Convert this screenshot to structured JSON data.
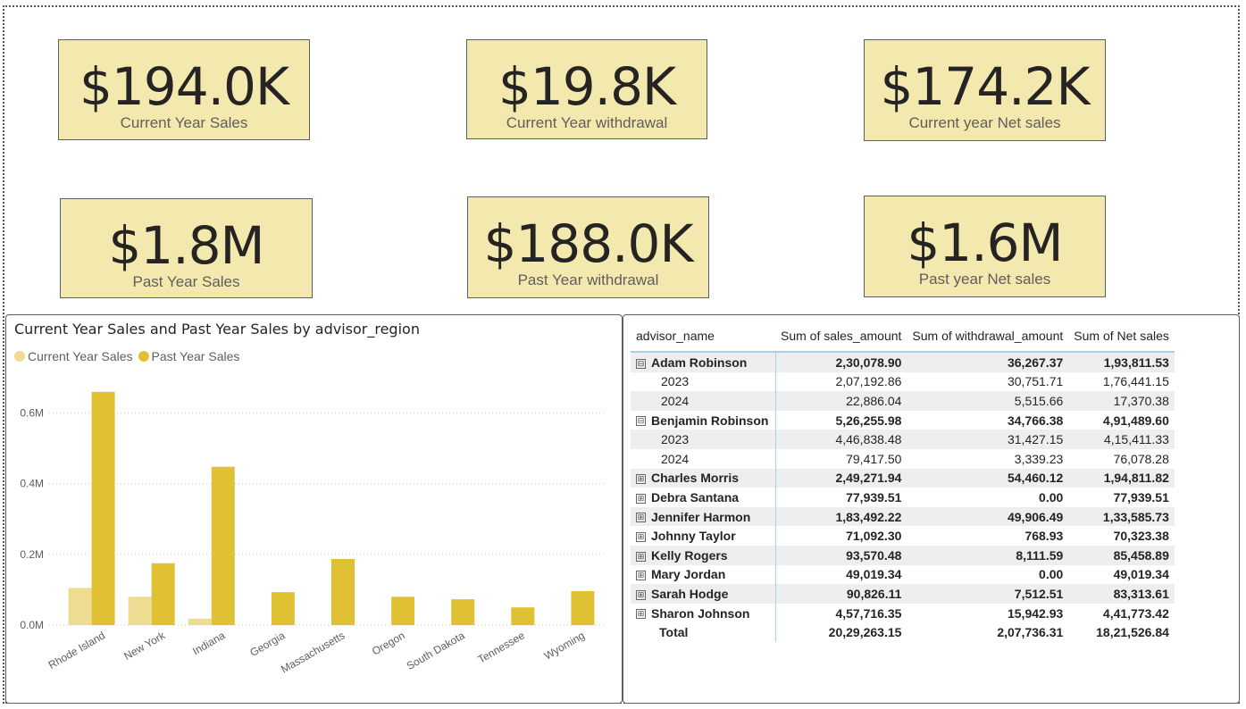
{
  "cards": [
    {
      "value": "$194.0K",
      "label": "Current Year  Sales"
    },
    {
      "value": "$19.8K",
      "label": "Current Year withdrawal"
    },
    {
      "value": "$174.2K",
      "label": "Current year Net sales"
    },
    {
      "value": "$1.8M",
      "label": "Past Year Sales"
    },
    {
      "value": "$188.0K",
      "label": "Past Year withdrawal"
    },
    {
      "value": "$1.6M",
      "label": "Past year Net sales"
    }
  ],
  "colors": {
    "card_bg": "#f3e8ae",
    "current": "#efdc93",
    "past": "#e0c133"
  },
  "chart_data": {
    "type": "bar",
    "title": "Current Year Sales and Past Year Sales by advisor_region",
    "categories": [
      "Rhode Island",
      "New York",
      "Indiana",
      "Georgia",
      "Massachusetts",
      "Oregon",
      "South Dakota",
      "Tennessee",
      "Wyoming"
    ],
    "series": [
      {
        "name": "Current Year  Sales",
        "values": [
          0.105,
          0.08,
          0.018,
          0,
          0,
          0,
          0,
          0,
          0
        ]
      },
      {
        "name": "Past Year Sales",
        "values": [
          0.66,
          0.175,
          0.448,
          0.093,
          0.187,
          0.08,
          0.073,
          0.05,
          0.096
        ]
      }
    ],
    "yticks": [
      "0.0M",
      "0.2M",
      "0.4M",
      "0.6M"
    ],
    "ytick_values": [
      0,
      0.2,
      0.4,
      0.6
    ],
    "ylim": [
      0,
      0.7
    ],
    "grid": true,
    "legend_position": "top-left"
  },
  "table": {
    "headers": [
      "advisor_name",
      "Sum of sales_amount",
      "Sum of withdrawal_amount",
      "Sum of Net sales"
    ],
    "rows": [
      {
        "name": "Adam Robinson",
        "level": 0,
        "toggle": "⊟",
        "sales": "2,30,078.90",
        "withdrawal": "36,267.37",
        "net": "1,93,811.53"
      },
      {
        "name": "2023",
        "level": 1,
        "toggle": "",
        "sales": "2,07,192.86",
        "withdrawal": "30,751.71",
        "net": "1,76,441.15"
      },
      {
        "name": "2024",
        "level": 1,
        "toggle": "",
        "sales": "22,886.04",
        "withdrawal": "5,515.66",
        "net": "17,370.38"
      },
      {
        "name": "Benjamin Robinson",
        "level": 0,
        "toggle": "⊟",
        "sales": "5,26,255.98",
        "withdrawal": "34,766.38",
        "net": "4,91,489.60"
      },
      {
        "name": "2023",
        "level": 1,
        "toggle": "",
        "sales": "4,46,838.48",
        "withdrawal": "31,427.15",
        "net": "4,15,411.33"
      },
      {
        "name": "2024",
        "level": 1,
        "toggle": "",
        "sales": "79,417.50",
        "withdrawal": "3,339.23",
        "net": "76,078.28"
      },
      {
        "name": "Charles Morris",
        "level": 0,
        "toggle": "⊞",
        "sales": "2,49,271.94",
        "withdrawal": "54,460.12",
        "net": "1,94,811.82"
      },
      {
        "name": "Debra Santana",
        "level": 0,
        "toggle": "⊞",
        "sales": "77,939.51",
        "withdrawal": "0.00",
        "net": "77,939.51"
      },
      {
        "name": "Jennifer Harmon",
        "level": 0,
        "toggle": "⊞",
        "sales": "1,83,492.22",
        "withdrawal": "49,906.49",
        "net": "1,33,585.73"
      },
      {
        "name": "Johnny Taylor",
        "level": 0,
        "toggle": "⊞",
        "sales": "71,092.30",
        "withdrawal": "768.93",
        "net": "70,323.38"
      },
      {
        "name": "Kelly Rogers",
        "level": 0,
        "toggle": "⊞",
        "sales": "93,570.48",
        "withdrawal": "8,111.59",
        "net": "85,458.89"
      },
      {
        "name": "Mary Jordan",
        "level": 0,
        "toggle": "⊞",
        "sales": "49,019.34",
        "withdrawal": "0.00",
        "net": "49,019.34"
      },
      {
        "name": "Sarah Hodge",
        "level": 0,
        "toggle": "⊞",
        "sales": "90,826.11",
        "withdrawal": "7,512.51",
        "net": "83,313.61"
      },
      {
        "name": "Sharon Johnson",
        "level": 0,
        "toggle": "⊞",
        "sales": "4,57,716.35",
        "withdrawal": "15,942.93",
        "net": "4,41,773.42"
      }
    ],
    "total": {
      "name": "Total",
      "sales": "20,29,263.15",
      "withdrawal": "2,07,736.31",
      "net": "18,21,526.84"
    }
  }
}
